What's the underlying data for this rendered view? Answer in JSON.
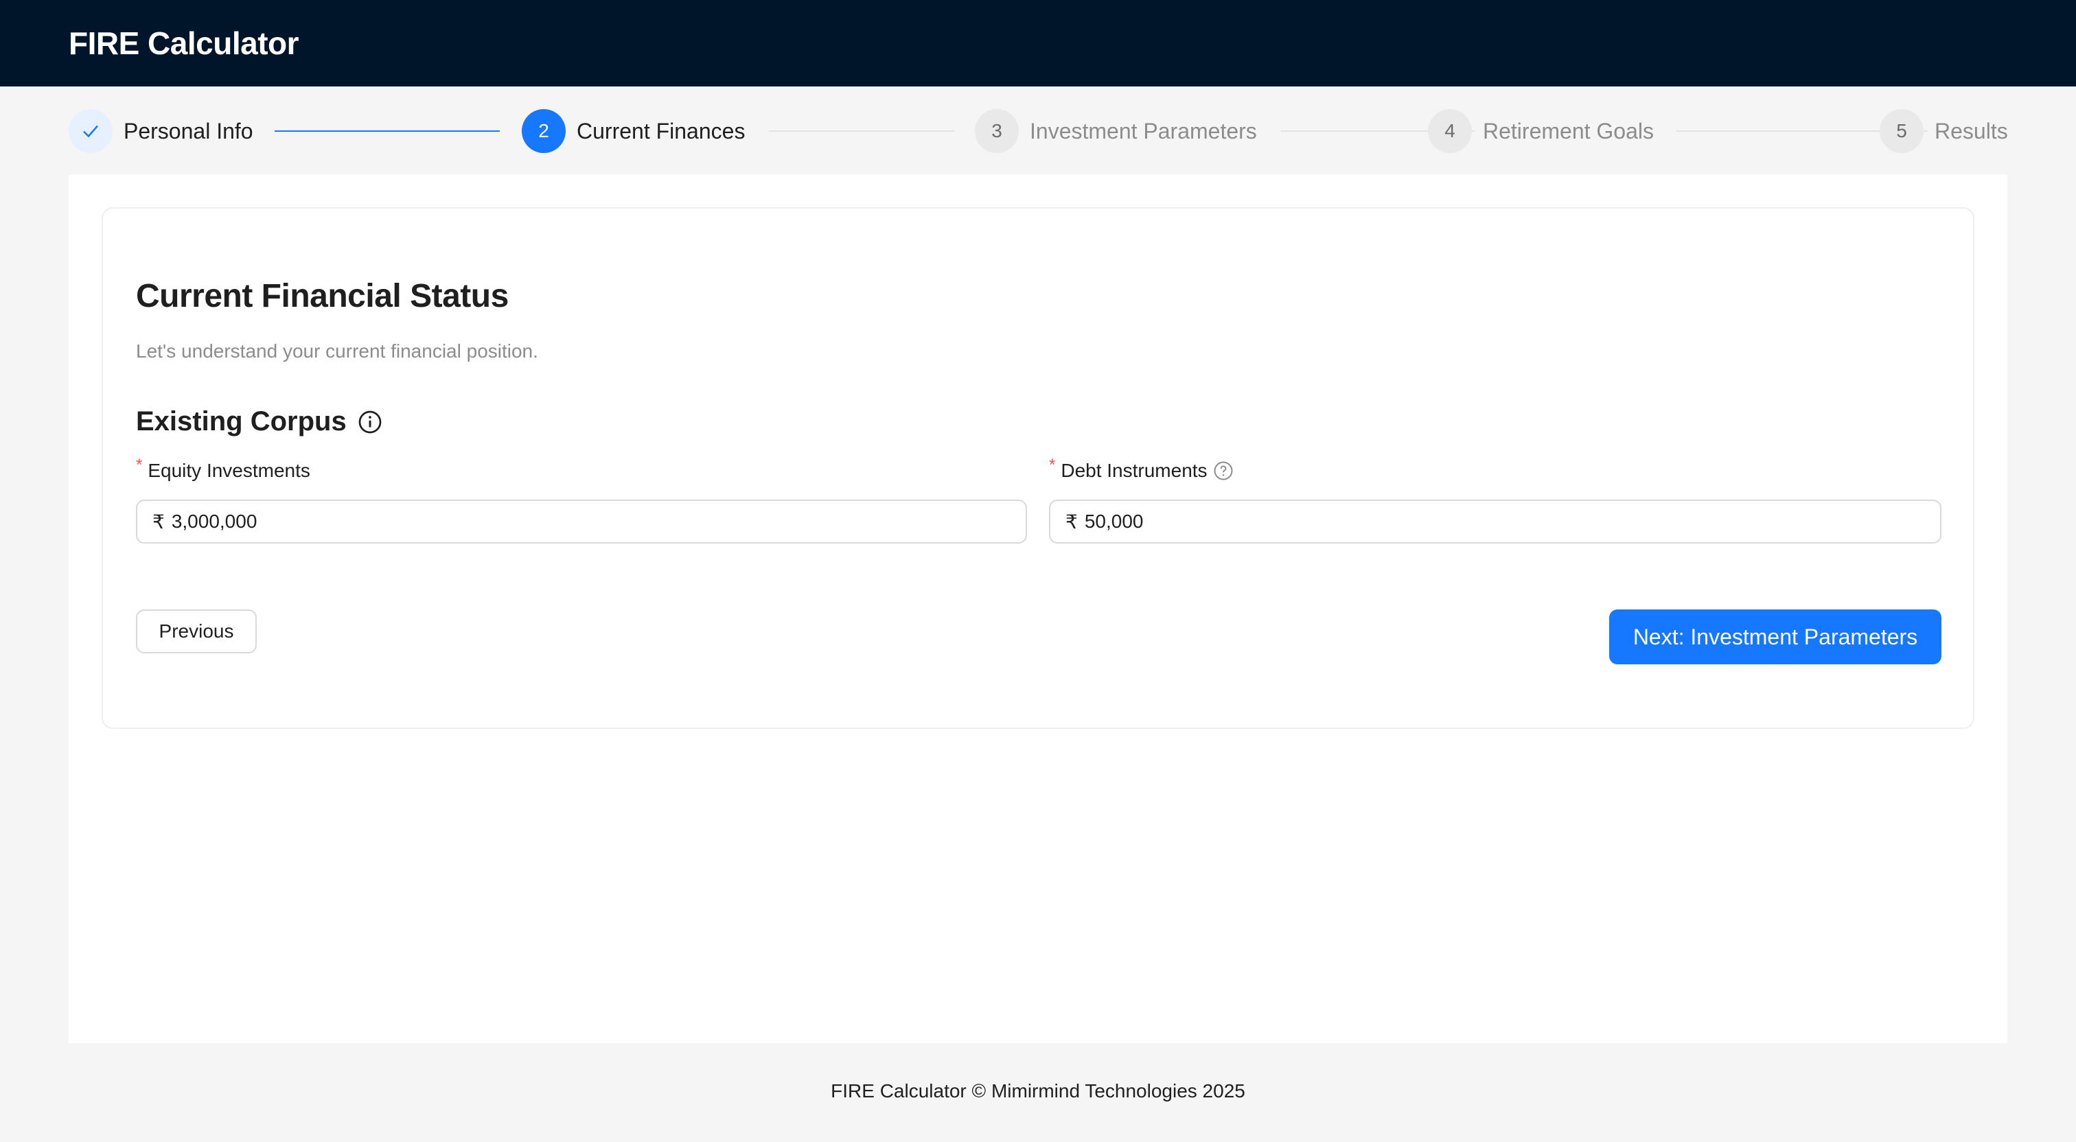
{
  "header": {
    "title": "FIRE Calculator"
  },
  "steps": [
    {
      "label": "Personal Info",
      "status": "done",
      "icon": "check-icon"
    },
    {
      "number": "2",
      "label": "Current Finances",
      "status": "active"
    },
    {
      "number": "3",
      "label": "Investment Parameters",
      "status": "wait"
    },
    {
      "number": "4",
      "label": "Retirement Goals",
      "status": "wait"
    },
    {
      "number": "5",
      "label": "Results",
      "status": "wait"
    }
  ],
  "form": {
    "title": "Current Financial Status",
    "subtitle": "Let's understand your current financial position.",
    "section_title": "Existing Corpus",
    "fields": [
      {
        "label": "Equity Investments",
        "required": "*",
        "prefix": "₹",
        "value": "3,000,000"
      },
      {
        "label": "Debt Instruments",
        "required": "*",
        "prefix": "₹",
        "value": "50,000"
      }
    ],
    "previous_label": "Previous",
    "next_label": "Next: Investment Parameters"
  },
  "footer": {
    "text": "FIRE Calculator © Mimirmind Technologies 2025"
  },
  "colors": {
    "primary": "#1677ff",
    "header_bg": "#001529",
    "required": "#ff4d4f"
  }
}
